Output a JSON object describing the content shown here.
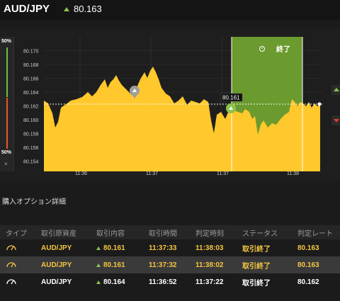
{
  "header": {
    "pair": "AUD/JPY",
    "rate": "80.163",
    "rate_direction": "up"
  },
  "scale": {
    "top_label": "50%",
    "bottom_label": "50%",
    "close": "×"
  },
  "chart": {
    "y_ticks": [
      "80.170",
      "80.168",
      "80.166",
      "80.164",
      "80.162",
      "80.160",
      "80.158",
      "80.156",
      "80.154"
    ],
    "x_ticks": [
      "11:36",
      "11:37",
      "11:37",
      "11:38"
    ],
    "callout": "80.161",
    "expiry_label": "終了",
    "colors": {
      "area": "#ffc82c",
      "expiry_zone": "#6b9a2e",
      "marker_up": "#8bc34a"
    }
  },
  "chart_data": {
    "type": "area",
    "x": [
      "11:35:50",
      "11:36:00",
      "11:36:10",
      "11:36:20",
      "11:36:30",
      "11:36:40",
      "11:36:50",
      "11:37:00",
      "11:37:10",
      "11:37:20",
      "11:37:30",
      "11:37:40",
      "11:37:50",
      "11:38:00",
      "11:38:10",
      "11:38:20"
    ],
    "values": [
      80.163,
      80.155,
      80.164,
      80.164,
      80.166,
      80.162,
      80.164,
      80.169,
      80.163,
      80.162,
      80.16,
      80.161,
      80.16,
      80.161,
      80.162,
      80.163
    ],
    "ylim": [
      80.153,
      80.172
    ],
    "xlabel": "",
    "ylabel": ""
  },
  "section": {
    "title": "購入オプション詳細"
  },
  "table": {
    "headers": [
      "タイプ",
      "取引原資産",
      "取引内容",
      "取引時間",
      "判定時刻",
      "ステータス",
      "判定レート"
    ],
    "rows": [
      {
        "type_icon": "gauge-icon",
        "asset": "AUD/JPY",
        "content": "80.161",
        "time": "11:37:33",
        "judge": "11:38:03",
        "status": "取引終了",
        "rate": "80.163"
      },
      {
        "type_icon": "gauge-icon",
        "asset": "AUD/JPY",
        "content": "80.161",
        "time": "11:37:32",
        "judge": "11:38:02",
        "status": "取引終了",
        "rate": "80.163"
      },
      {
        "type_icon": "gauge-icon",
        "asset": "AUD/JPY",
        "content": "80.164",
        "time": "11:36:52",
        "judge": "11:37:22",
        "status": "取引終了",
        "rate": "80.162"
      }
    ]
  }
}
